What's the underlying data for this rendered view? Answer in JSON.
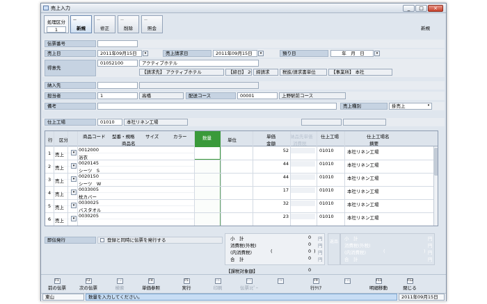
{
  "window": {
    "title": "売上入力",
    "controls": [
      "_",
      "□",
      "×"
    ]
  },
  "toolbar": {
    "mode_label": "処理区分",
    "mode_value": "1",
    "buttons": [
      {
        "label": "新規",
        "active": true
      },
      {
        "label": "修正"
      },
      {
        "label": "削除"
      },
      {
        "label": "照会"
      }
    ],
    "mode_indicator": "新規"
  },
  "header": {
    "slip_no_label": "伝票番号",
    "slip_no": "",
    "sales_date_label": "売上日",
    "sales_date": "2011年09月15日",
    "billing_date_label": "売上請求日",
    "billing_date": "2011年09月15日",
    "deposit_label": "預り日",
    "deposit_date": "年　月　日",
    "customer_label": "得意先",
    "customer_code": "01052100",
    "customer_name": "アクティブホテル",
    "bill_to": "【請求先】 アクティブホテル",
    "closing": "【締日】 20",
    "billing_type": "締請求",
    "slip_unit": "税抜/請求書単位",
    "office": "【事業所】 本社",
    "delivery_label": "納入先",
    "delivery": "",
    "staff_label": "担当者",
    "staff_code": "1",
    "staff_name": "高橋",
    "route_label": "配送コース",
    "route_code": "00001",
    "route_name": "上野駅前コース",
    "remarks_label": "備考",
    "remarks": "",
    "sales_type_label": "売上種別",
    "sales_type": "掛売上",
    "factory_label": "仕上工場",
    "factory_code": "01010",
    "factory_name": "本社リネン工場"
  },
  "grid": {
    "headers": {
      "row": "行",
      "kubun": "区分",
      "code": "商品コード",
      "type": "型番・規格",
      "size": "サイズ",
      "color": "カラー",
      "name": "商品名",
      "qty": "数量",
      "unit": "単位",
      "price": "単価",
      "amount": "金額",
      "price_sub1": "納品先単価",
      "price_sub2": "消費税",
      "factory": "仕上工場",
      "factory_name": "仕上工場名",
      "note": "摘要"
    },
    "rows": [
      {
        "no": "1",
        "kubun": "売上",
        "code": "0012000",
        "name": "浴衣",
        "qty": "",
        "price": "52",
        "factory": "01010",
        "factory_name": "本社リネン工場"
      },
      {
        "no": "2",
        "kubun": "売上",
        "code": "0020145",
        "name": "シーツ　S",
        "qty": "",
        "price": "44",
        "factory": "01010",
        "factory_name": "本社リネン工場"
      },
      {
        "no": "3",
        "kubun": "売上",
        "code": "0020150",
        "name": "シーツ　W",
        "qty": "",
        "price": "44",
        "factory": "01010",
        "factory_name": "本社リネン工場"
      },
      {
        "no": "4",
        "kubun": "売上",
        "code": "0033005",
        "name": "枕カバー",
        "qty": "",
        "price": "17",
        "factory": "01010",
        "factory_name": "本社リネン工場"
      },
      {
        "no": "5",
        "kubun": "売上",
        "code": "0030025",
        "name": "バスタオル",
        "qty": "",
        "price": "32",
        "factory": "01010",
        "factory_name": "本社リネン工場"
      },
      {
        "no": "6",
        "kubun": "売上",
        "code": "0030205",
        "name": "",
        "qty": "",
        "price": "23",
        "factory": "01010",
        "factory_name": "本社リネン工場"
      }
    ]
  },
  "footer": {
    "issue_label": "即伝発行",
    "issue_check": "登録と同時に伝票を発行する",
    "subtotal_label": "小　計",
    "subtotal": "0",
    "tax_out_label": "消費税(外税)",
    "tax_out": "0",
    "tax_in_label": "(内消費税)",
    "tax_in_open": "(",
    "tax_in": "0",
    "tax_in_close": ")",
    "total_label": "合　計",
    "total": "0",
    "taxable_label": "【課税対象額】",
    "taxable": "0",
    "yen": "円",
    "ret_title": "返品",
    "ret_subtotal_label": "小　計",
    "ret_tax_out_label": "消費税(外税)",
    "ret_tax_in_label": "(内消費税)",
    "ret_total_label": "合　計",
    "ret_open": "(",
    "ret_close": ")"
  },
  "fkeys": [
    {
      "key": "F1",
      "label": "前の伝票",
      "enabled": true
    },
    {
      "key": "F2",
      "label": "次の伝票",
      "enabled": true
    },
    {
      "key": "F3",
      "label": "検索",
      "enabled": false
    },
    {
      "key": "F4",
      "label": "単価参照",
      "enabled": true
    },
    {
      "key": "F5",
      "label": "実行",
      "enabled": true
    },
    {
      "key": "F6",
      "label": "印刷",
      "enabled": false
    },
    {
      "key": "F7",
      "label": "伝票ｺﾋﾟｰ",
      "enabled": false
    },
    {
      "key": "F8",
      "label": "",
      "enabled": false
    },
    {
      "key": "F9",
      "label": "行ｸﾘｱ",
      "enabled": true
    },
    {
      "key": "F10",
      "label": "",
      "enabled": false
    },
    {
      "key": "F11",
      "label": "明細移動",
      "enabled": true
    },
    {
      "key": "F12",
      "label": "閉じる",
      "enabled": true
    }
  ],
  "status": {
    "user": "東山",
    "message": "数量を入力してください。",
    "date": "2011年09月15日"
  }
}
